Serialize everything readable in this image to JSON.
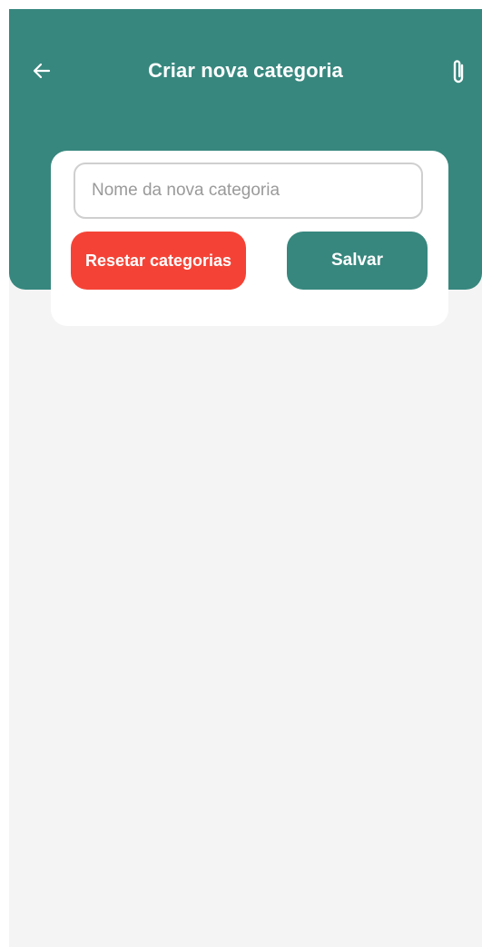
{
  "header": {
    "title": "Criar nova categoria",
    "back_icon": "arrow-left-icon",
    "attach_icon": "paperclip-icon"
  },
  "form": {
    "name_placeholder": "Nome da nova categoria",
    "name_value": "",
    "reset_label": "Resetar categorias",
    "save_label": "Salvar"
  },
  "colors": {
    "primary": "#37877e",
    "danger": "#f44336",
    "background": "#f4f4f4",
    "card": "#ffffff"
  }
}
